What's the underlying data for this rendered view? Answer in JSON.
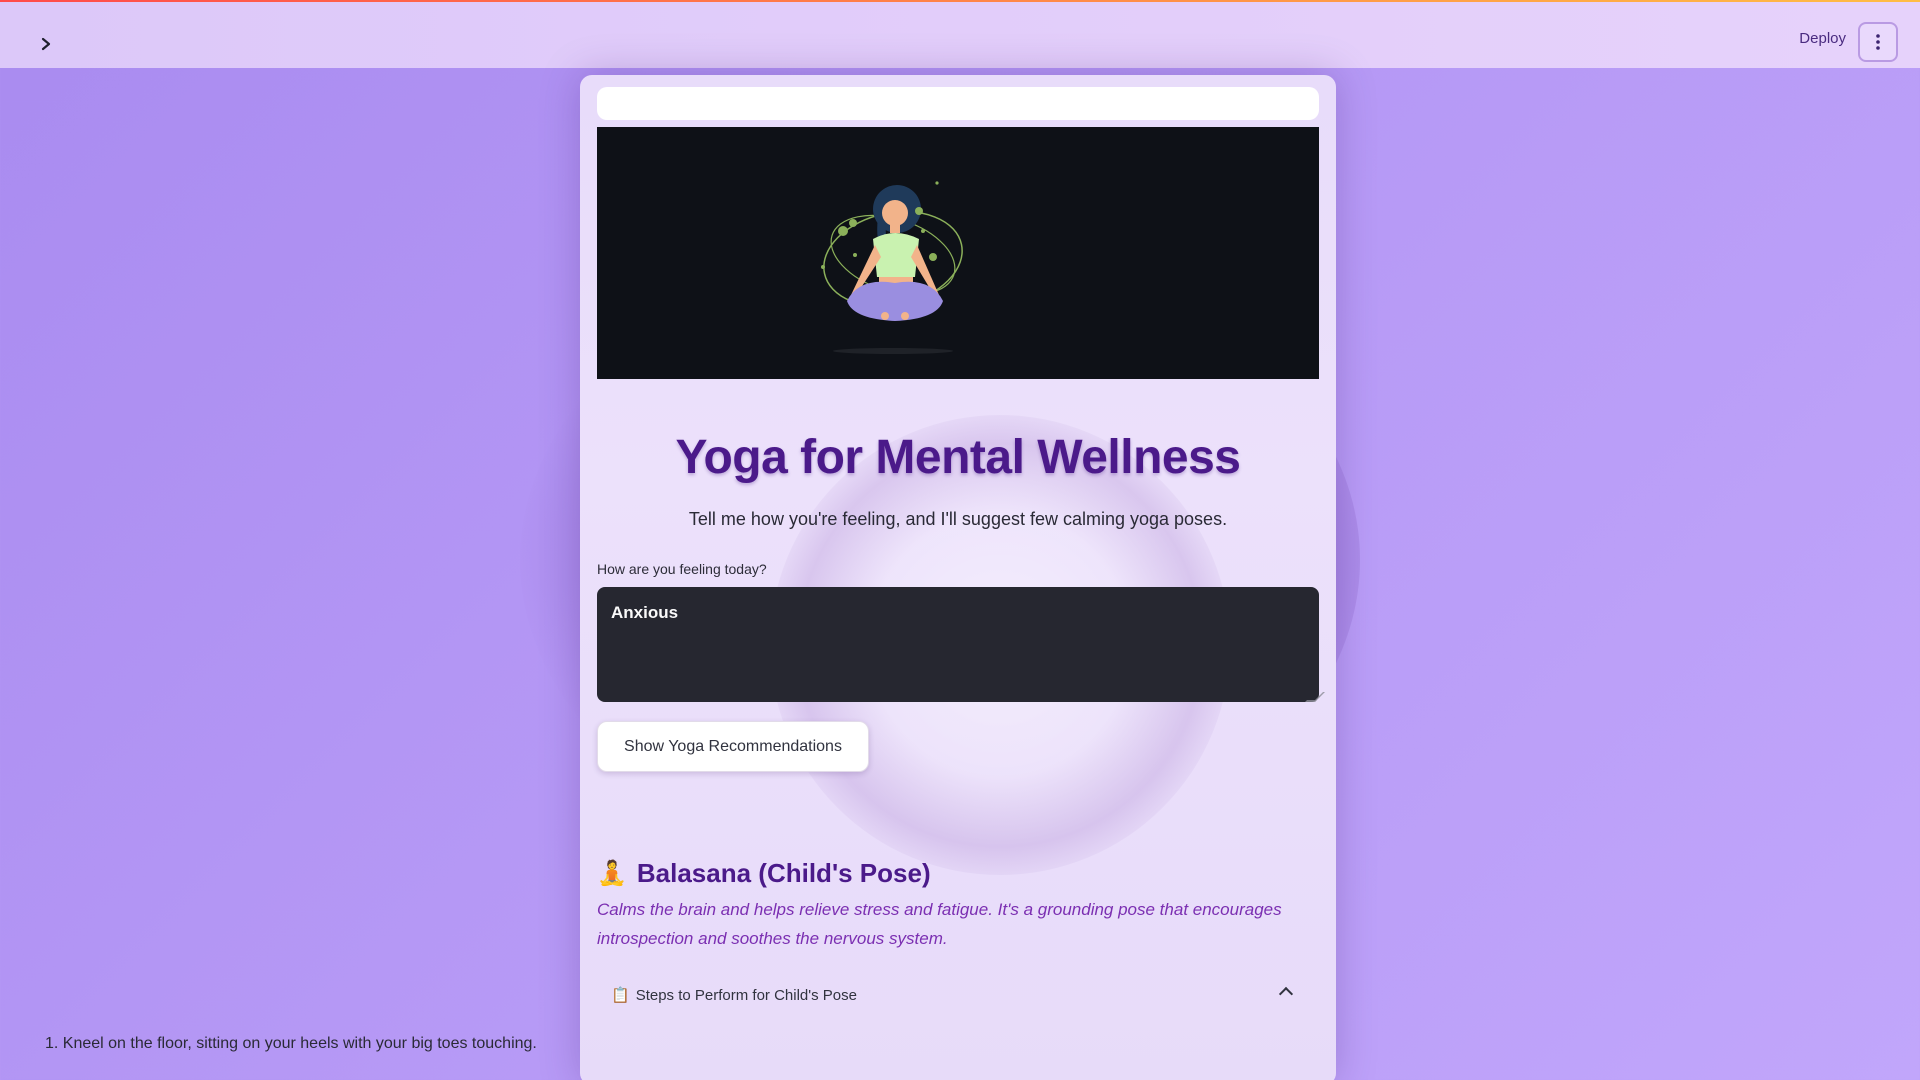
{
  "header": {
    "deploy_label": "Deploy",
    "sidebar_toggle_icon": "chevron-right-icon",
    "menu_icon": "vertical-dots-icon"
  },
  "hero": {
    "image_name": "meditating-woman-illustration"
  },
  "main": {
    "title": "Yoga for Mental Wellness",
    "subtitle": "Tell me how you're feeling, and I'll suggest few calming yoga poses.",
    "feeling_label": "How are you feeling today?",
    "feeling_value": "Anxious",
    "recommend_button": "Show Yoga Recommendations"
  },
  "pose": {
    "emoji": "🧘",
    "title": "Balasana (Child's Pose)",
    "description": "Calms the brain and helps relieve stress and fatigue. It's a grounding pose that encourages introspection and soothes the nervous system.",
    "steps_icon": "📋",
    "steps_label": "Steps to Perform for Child's Pose",
    "steps": [
      "1. Kneel on the floor, sitting on your heels with your big toes touching."
    ]
  },
  "colors": {
    "accent": "#4b1a8a",
    "italic_text": "#7b2fb2",
    "input_bg": "#262730"
  }
}
